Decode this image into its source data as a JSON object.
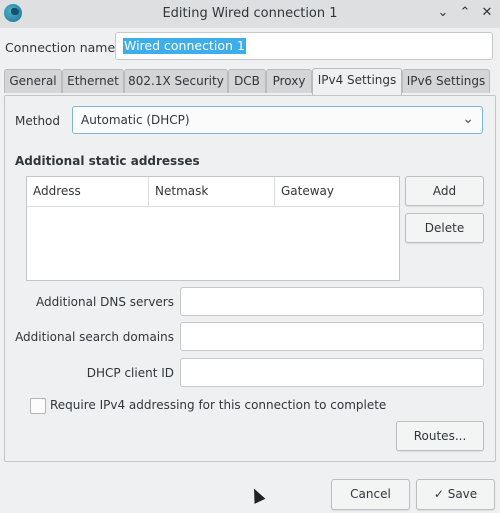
{
  "window": {
    "title": "Editing Wired connection 1",
    "icon": "network-manager-icon",
    "controls": [
      "minimize",
      "maximize",
      "close"
    ]
  },
  "connection_name": {
    "label": "Connection name",
    "value": "Wired connection 1"
  },
  "tabs": [
    {
      "label": "General",
      "active": false
    },
    {
      "label": "Ethernet",
      "active": false
    },
    {
      "label": "802.1X Security",
      "active": false
    },
    {
      "label": "DCB",
      "active": false
    },
    {
      "label": "Proxy",
      "active": false
    },
    {
      "label": "IPv4 Settings",
      "active": true
    },
    {
      "label": "IPv6 Settings",
      "active": false
    }
  ],
  "ipv4": {
    "method_label": "Method",
    "method_value": "Automatic (DHCP)",
    "static_heading": "Additional static addresses",
    "table_columns": [
      "Address",
      "Netmask",
      "Gateway"
    ],
    "table_rows": [],
    "add_button": "Add",
    "delete_button": "Delete",
    "dns_label": "Additional DNS servers",
    "dns_value": "",
    "search_label": "Additional search domains",
    "search_value": "",
    "dhcp_label": "DHCP client ID",
    "dhcp_value": "",
    "require_label": "Require IPv4 addressing for this connection to complete",
    "require_checked": false,
    "routes_button": "Routes..."
  },
  "footer": {
    "cancel_button": "Cancel",
    "save_button": "Save",
    "save_icon": "checkmark-icon"
  }
}
